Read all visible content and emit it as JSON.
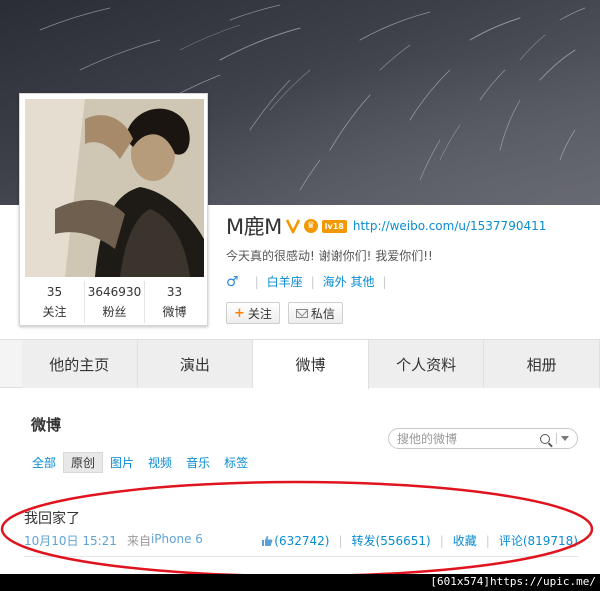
{
  "profile": {
    "name": "M鹿M",
    "level_badge": "lv18",
    "url": "http://weibo.com/u/1537790411",
    "bio": "今天真的很感动! 谢谢你们! 我爱你们!!",
    "gender_symbol": "♂",
    "zodiac": "白羊座",
    "location": "海外 其他",
    "follow_label": "关注",
    "message_label": "私信"
  },
  "stats": [
    {
      "value": "35",
      "label": "关注"
    },
    {
      "value": "3646930",
      "label": "粉丝"
    },
    {
      "value": "33",
      "label": "微博"
    }
  ],
  "tabs": [
    "他的主页",
    "演出",
    "微博",
    "个人资料",
    "相册"
  ],
  "active_tab": 2,
  "feed": {
    "title": "微博",
    "search_placeholder": "搜他的微博",
    "filters": [
      "全部",
      "原创",
      "图片",
      "视频",
      "音乐",
      "标签"
    ],
    "active_filter": 1
  },
  "post": {
    "text": "我回家了",
    "date": "10月10日 15:21",
    "source_prefix": "来自",
    "source": "iPhone 6",
    "likes": "(632742)",
    "repost": "转发(556651)",
    "favorite": "收藏",
    "comment": "评论(819718)"
  },
  "watermark": "[601x574]https://upic.me/",
  "colors": {
    "accent": "#0a8cd2",
    "highlight": "#e0141e",
    "orange": "#f39800"
  }
}
